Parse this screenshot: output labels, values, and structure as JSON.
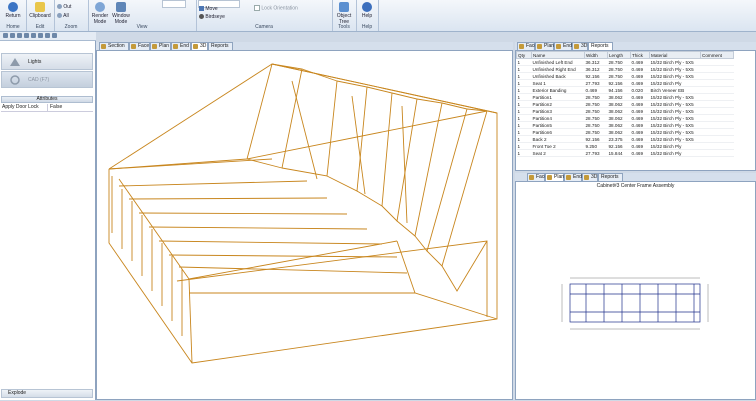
{
  "ribbon": {
    "groups": [
      {
        "label": "Home",
        "buttons": [
          "Return"
        ]
      },
      {
        "label": "Edit",
        "buttons": [
          "Clipboard"
        ]
      },
      {
        "label": "Zoom",
        "buttons": [
          "Out",
          "All"
        ]
      },
      {
        "label": "View",
        "buttons": [
          "Render Mode",
          "Window Mode"
        ]
      },
      {
        "label": "Camera",
        "buttons": [
          "Move",
          "Birdseye",
          "Lock Orientation"
        ]
      },
      {
        "label": "Tools",
        "buttons": [
          "Object Tree"
        ]
      },
      {
        "label": "Help",
        "buttons": [
          "Help"
        ]
      }
    ]
  },
  "left_panel": {
    "items": [
      "Lights",
      "CAD (F7)"
    ],
    "attributes_header": "Attributes",
    "attribute_rows": [
      {
        "name": "Apply Door Lock",
        "value": "False"
      }
    ],
    "bottom_button": "Explode"
  },
  "main_tabs": [
    "Section",
    "Face",
    "Plan",
    "End",
    "3D",
    "Reports"
  ],
  "top_right_tabs": [
    "Face",
    "Plan",
    "End",
    "3D",
    "Reports"
  ],
  "bottom_right_tabs": [
    "Face",
    "Plan",
    "End",
    "3D",
    "Reports"
  ],
  "parts_table": {
    "columns": [
      "Qty",
      "Name",
      "Width",
      "Length",
      "Thick",
      "Material",
      "Comment"
    ],
    "rows": [
      [
        "1",
        "Unfinished Left End",
        "36.312",
        "28.750",
        "0.469",
        "15/32 Birch Ply - 5X5",
        ""
      ],
      [
        "1",
        "Unfinished Right End",
        "36.312",
        "28.750",
        "0.469",
        "15/32 Birch Ply - 5X5",
        ""
      ],
      [
        "1",
        "Unfinished Back",
        "92.156",
        "28.750",
        "0.469",
        "15/32 Birch Ply - 5X5",
        ""
      ],
      [
        "1",
        "Seat 1",
        "27.793",
        "92.156",
        "0.469",
        "15/32 Birch Ply",
        ""
      ],
      [
        "1",
        "Exterior Banding",
        "0.469",
        "94.156",
        "0.020",
        "Birch Veneer EB",
        ""
      ],
      [
        "1",
        "Partition1",
        "28.750",
        "38.062",
        "0.469",
        "15/32 Birch Ply - 5X5",
        ""
      ],
      [
        "1",
        "Partition2",
        "28.750",
        "38.062",
        "0.469",
        "15/32 Birch Ply - 5X5",
        ""
      ],
      [
        "1",
        "Partition3",
        "28.750",
        "38.062",
        "0.469",
        "15/32 Birch Ply - 5X5",
        ""
      ],
      [
        "1",
        "Partition4",
        "28.750",
        "38.062",
        "0.469",
        "15/32 Birch Ply - 5X5",
        ""
      ],
      [
        "1",
        "Partition5",
        "28.750",
        "38.062",
        "0.469",
        "15/32 Birch Ply - 5X5",
        ""
      ],
      [
        "1",
        "Partition6",
        "28.750",
        "38.062",
        "0.469",
        "15/32 Birch Ply - 5X5",
        ""
      ],
      [
        "1",
        "Back 2",
        "92.156",
        "23.375",
        "0.469",
        "15/32 Birch Ply - 5X5",
        ""
      ],
      [
        "1",
        "Front Toe 2",
        "9.250",
        "92.156",
        "0.469",
        "15/32 Birch Ply",
        ""
      ],
      [
        "1",
        "Seat 2",
        "27.793",
        "15.844",
        "0.469",
        "15/32 Birch Ply",
        ""
      ]
    ]
  },
  "plan_view": {
    "title": "Cabinet#3 Center Frame Assembly"
  },
  "colors": {
    "wireframe": "#c8861e",
    "ribbon_border": "#9fb3cc",
    "panel_border": "#8ea3bf"
  }
}
